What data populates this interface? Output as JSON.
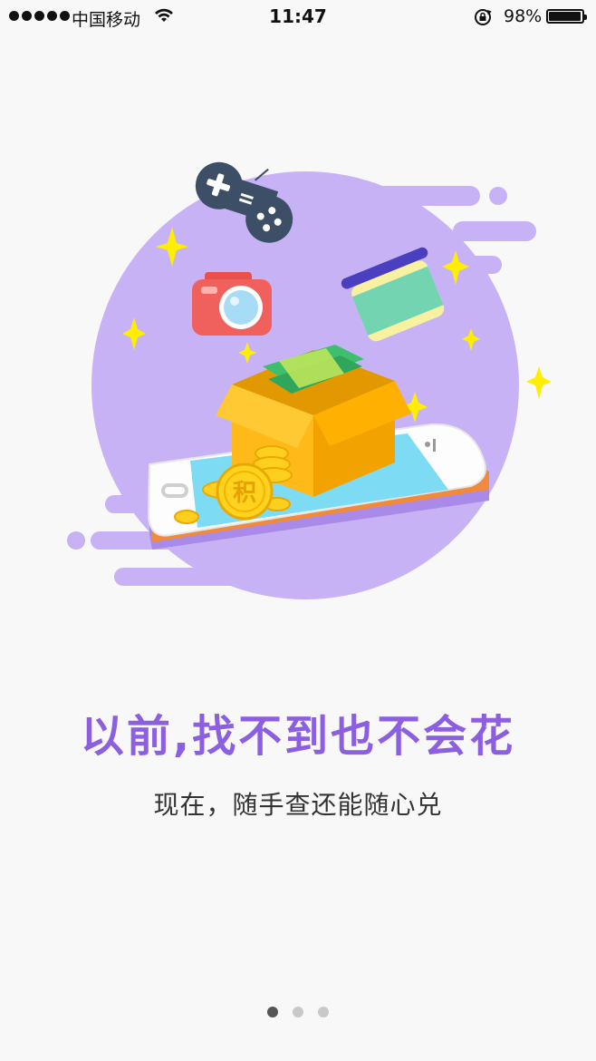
{
  "status_bar": {
    "carrier": "中国移动",
    "time": "11:47",
    "battery_percent_label": "98%",
    "battery_level": 0.98
  },
  "illustration": {
    "icons": [
      "gamepad-icon",
      "camera-icon",
      "snack-can-icon",
      "gift-box-icon",
      "phone-icon",
      "coins-icon",
      "sparkle-icon"
    ],
    "coin_label": "积",
    "colors": {
      "circle": "#c8b2f6",
      "box": "#ffb400",
      "cash": "#3dbf6e",
      "camera": "#f0605c",
      "gamepad": "#3d4f66"
    }
  },
  "headline": "以前,找不到也不会花",
  "subline": "现在，随手查还能随心兑",
  "pager": {
    "count": 3,
    "active_index": 0
  }
}
